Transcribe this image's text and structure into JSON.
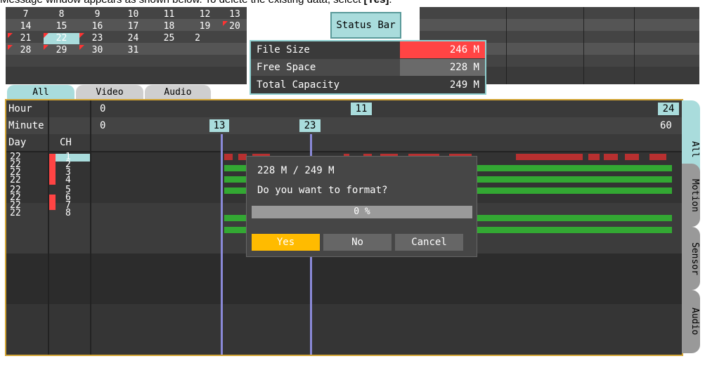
{
  "instruction": {
    "prefix": "Message window appears as shown below. To delete the existing data, select ",
    "bold": "[Yes]",
    "suffix": "."
  },
  "calendar": {
    "rows": [
      [
        "7",
        "8",
        "9",
        "10",
        "11",
        "12",
        "13"
      ],
      [
        "14",
        "15",
        "16",
        "17",
        "18",
        "19",
        "20"
      ],
      [
        "21",
        "22",
        "23",
        "24",
        "25",
        "2",
        ""
      ],
      [
        "28",
        "29",
        "30",
        "31",
        "",
        "",
        ""
      ]
    ],
    "selected_day": "22"
  },
  "status_bar": {
    "button_label": "Status Bar",
    "rows": [
      {
        "label": "File Size",
        "value": "246 M"
      },
      {
        "label": "Free Space",
        "value": "228 M"
      },
      {
        "label": "Total Capacity",
        "value": "249 M"
      }
    ]
  },
  "tabs": [
    "All",
    "Video",
    "Audio"
  ],
  "timeline": {
    "hour_label": "Hour",
    "minute_label": "Minute",
    "day_label": "Day",
    "ch_label": "CH",
    "hour_start": "0",
    "hour_mid": "11",
    "hour_end": "24",
    "min_start": "0",
    "min_marker1": "13",
    "min_marker2": "23",
    "min_end": "60",
    "days": [
      "22",
      "22",
      "22",
      "22",
      "22",
      "22",
      "22",
      "22"
    ],
    "channels": [
      "1",
      "2",
      "3",
      "4",
      "5",
      "6",
      "7",
      "8"
    ]
  },
  "side_tabs": [
    "All",
    "Motion",
    "Sensor",
    "Audio"
  ],
  "dialog": {
    "capacity": "228 M / 249 M",
    "question": "Do you want to format?",
    "progress": "0 %",
    "yes": "Yes",
    "no": "No",
    "cancel": "Cancel"
  },
  "colors": {
    "accent": "#a9dcdc",
    "highlight": "#ff4444",
    "recording_green": "#33a833",
    "event_red": "#b83030",
    "yes_button": "#ffbb00",
    "border_gold": "#d1a332"
  }
}
